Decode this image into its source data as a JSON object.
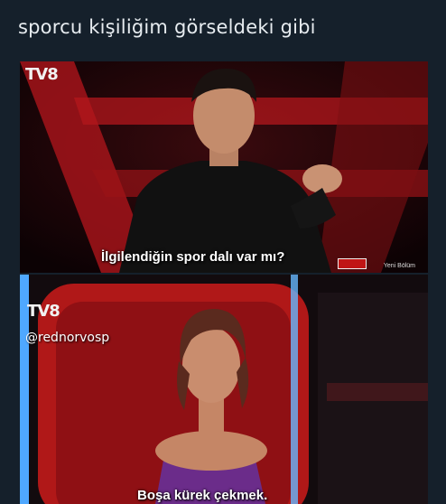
{
  "post": {
    "caption": "sporcu kişiliğim görseldeki gibi"
  },
  "panel_top": {
    "logo": "TV8",
    "subtitle": "İlgilendiğin spor dalı var mı?",
    "episode_badge": "Yeni Bölüm"
  },
  "panel_bottom": {
    "logo": "TV8",
    "watermark": "@rednorvosp",
    "subtitle": "Boşa kürek çekmek."
  },
  "colors": {
    "background": "#15202b",
    "caption_text": "#e7ecf0",
    "studio_red": "#b01818"
  }
}
